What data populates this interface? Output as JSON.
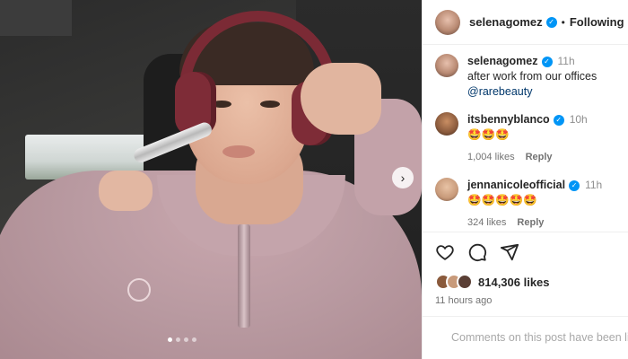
{
  "post": {
    "username": "selenagomez",
    "separator": "•",
    "follow_status": "Following",
    "caption": {
      "username": "selenagomez",
      "time": "11h",
      "text": "after work from our offices",
      "mention": "@rarebeauty"
    },
    "comments": [
      {
        "username": "itsbennyblanco",
        "time": "10h",
        "text": "🤩🤩🤩",
        "likes": "1,004 likes",
        "reply": "Reply"
      },
      {
        "username": "jennanicoleofficial",
        "time": "11h",
        "text": "🤩🤩🤩🤩🤩",
        "likes": "324 likes",
        "reply": "Reply"
      }
    ],
    "likes": "814,306 likes",
    "posted_ago": "11 hours ago",
    "comments_status": "Comments on this post have been limited",
    "carousel": {
      "slides": 4,
      "active": 0
    },
    "next_symbol": "›"
  },
  "colors": {
    "verified": "#0095f6",
    "link": "#00376b",
    "muted": "#737373"
  },
  "icons": [
    "heart-icon",
    "comment-icon",
    "share-icon",
    "verified-badge-icon",
    "next-arrow-icon"
  ]
}
